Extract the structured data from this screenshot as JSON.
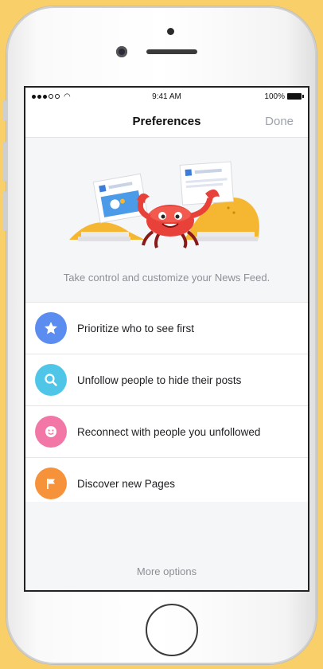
{
  "status_bar": {
    "time": "9:41 AM",
    "battery": "100%"
  },
  "nav": {
    "title": "Preferences",
    "done_label": "Done"
  },
  "hero": {
    "tagline": "Take control and customize your News Feed."
  },
  "options": [
    {
      "label": "Prioritize who to see first",
      "icon": "star-icon",
      "color": "#5b8cf0"
    },
    {
      "label": "Unfollow people to hide their posts",
      "icon": "search-icon",
      "color": "#4fc6e8"
    },
    {
      "label": "Reconnect with people you unfollowed",
      "icon": "smiley-icon",
      "color": "#f277a6"
    },
    {
      "label": "Discover new Pages",
      "icon": "flag-icon",
      "color": "#f6933a"
    }
  ],
  "footer": {
    "more_label": "More options"
  },
  "colors": {
    "background": "#f9cf6a",
    "accent_gray": "#9ea2aa"
  }
}
